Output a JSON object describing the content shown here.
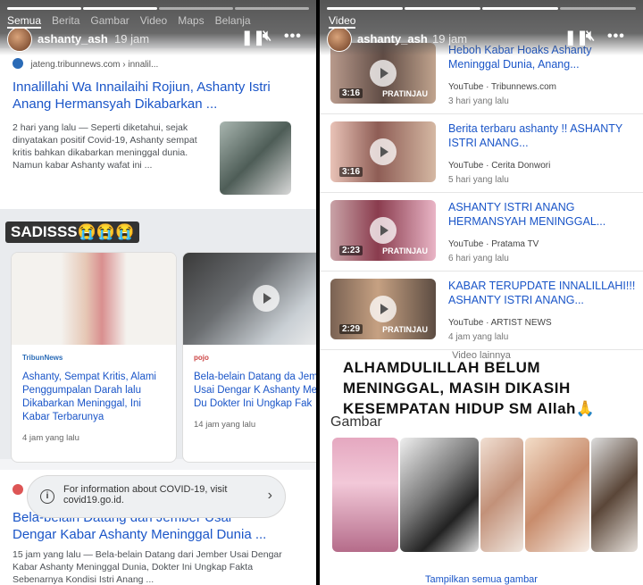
{
  "left_story": {
    "nav_tabs": [
      "Semua",
      "Berita",
      "Gambar",
      "Video",
      "Maps",
      "Belanja"
    ],
    "username": "ashanty_ash",
    "time": "19 jam",
    "result1": {
      "source": "jateng.tribunnews.com › innalil...",
      "title": "Innalillahi Wa Innailaihi Rojiun, Ashanty Istri Anang Hermansyah Dikabarkan ...",
      "snippet": "2 hari yang lalu — Seperti diketahui, sejak dinyatakan positif Covid-19, Ashanty sempat kritis bahkan dikabarkan meninggal dunia. Namun kabar Ashanty wafat ini ..."
    },
    "sticker": "SADISSS😭😭😭",
    "card1": {
      "publisher": "TribunNews",
      "title": "Ashanty, Sempat Kritis, Alami Penggumpalan Darah lalu Dikabarkan Meninggal, Ini Kabar Terbarunya",
      "age": "4 jam yang lalu"
    },
    "card2": {
      "publisher": "pojo",
      "title": "Bela-belain Datang da Jember Usai Dengar K Ashanty Meninggal Du Dokter Ini Ungkap Fak",
      "age": "14 jam yang lalu"
    },
    "covid_notice": {
      "text_line1": "For information about COVID-19, visit",
      "text_line2": "covid19.go.id."
    },
    "result2": {
      "title_line1": "Bela-belain Datang dari Jember Usai",
      "title_line2": "Dengar Kabar Ashanty Meninggal Dunia ...",
      "snippet": "15 jam yang lalu — Bela-belain Datang dari Jember Usai Dengar Kabar Ashanty Meninggal Dunia, Dokter Ini Ungkap Fakta Sebenarnya Kondisi Istri Anang ..."
    }
  },
  "right_story": {
    "section_label": "Video",
    "username": "ashanty_ash",
    "time": "19 jam",
    "videos": [
      {
        "title": "Heboh Kabar Hoaks Ashanty Meninggal Dunia, Anang...",
        "platform": "YouTube",
        "channel": "Tribunnews.com",
        "age": "3 hari yang lalu",
        "duration": "3:16",
        "badge": "PRATINJAU"
      },
      {
        "title": "Berita terbaru ashanty !! ASHANTY ISTRI ANANG...",
        "platform": "YouTube",
        "channel": "Cerita Donwori",
        "age": "5 hari yang lalu",
        "duration": "3:16",
        "badge": "PRATINJAU"
      },
      {
        "title": "ASHANTY ISTRI ANANG HERMANSYAH MENINGGAL...",
        "platform": "YouTube",
        "channel": "Pratama TV",
        "age": "6 hari yang lalu",
        "duration": "2:23",
        "badge": "PRATINJAU"
      },
      {
        "title": "KABAR TERUPDATE INNALILLAHI!!! ASHANTY ISTRI ANANG...",
        "platform": "YouTube",
        "channel": "ARTIST NEWS",
        "age": "4 jam yang lalu",
        "duration": "2:29",
        "badge": "PRATINJAU"
      }
    ],
    "more_videos": "Video lainnya",
    "caption": "ALHAMDULILLAH BELUM MENINGGAL, MASIH DIKASIH KESEMPATAN HIDUP SM Allah🙏",
    "images_label": "Gambar",
    "show_all_images": "Tampilkan semua gambar"
  },
  "icons": {
    "pause": "pause-icon",
    "mute": "mute-icon",
    "more": "more-icon",
    "play": "play-icon",
    "info": "info-icon",
    "chevron": "chevron-right-icon"
  },
  "colors": {
    "link_blue": "#1a55c8",
    "story_overlay": "#555555"
  }
}
